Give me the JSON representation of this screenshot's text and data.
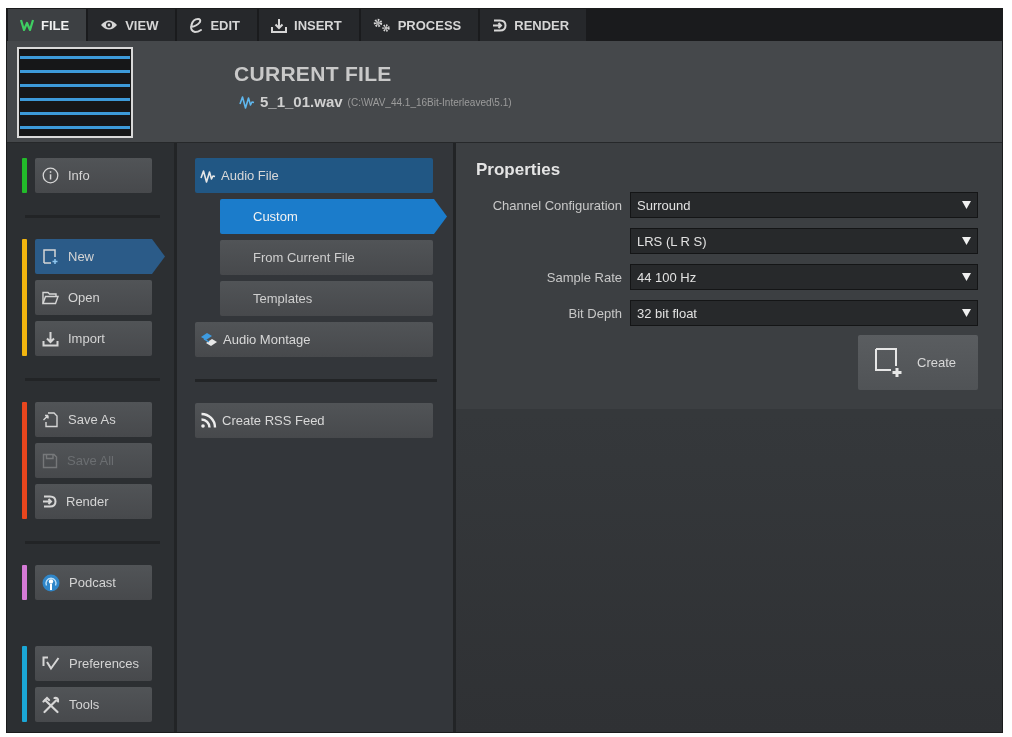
{
  "tabs": [
    {
      "label": "FILE",
      "selected": true
    },
    {
      "label": "VIEW",
      "selected": false
    },
    {
      "label": "EDIT",
      "selected": false
    },
    {
      "label": "INSERT",
      "selected": false
    },
    {
      "label": "PROCESS",
      "selected": false
    },
    {
      "label": "RENDER",
      "selected": false
    }
  ],
  "current_file": {
    "title": "CURRENT FILE",
    "file_name": "5_1_01.wav",
    "path": "(C:\\WAV_44.1_16Bit-Interleaved\\5.1)"
  },
  "sidebar": {
    "groups": [
      {
        "color": "#22bb2a",
        "items": [
          {
            "label": "Info",
            "selected": false,
            "disabled": false
          }
        ]
      },
      {
        "color": "#f2b50f",
        "items": [
          {
            "label": "New",
            "selected": true,
            "disabled": false
          },
          {
            "label": "Open",
            "selected": false,
            "disabled": false
          },
          {
            "label": "Import",
            "selected": false,
            "disabled": false
          }
        ]
      },
      {
        "color": "#e8461e",
        "items": [
          {
            "label": "Save As",
            "selected": false,
            "disabled": false
          },
          {
            "label": "Save All",
            "selected": false,
            "disabled": true
          },
          {
            "label": "Render",
            "selected": false,
            "disabled": false
          }
        ]
      },
      {
        "color": "#d57ad6",
        "items": [
          {
            "label": "Podcast",
            "selected": false,
            "disabled": false
          }
        ]
      },
      {
        "color": "#1ba7d6",
        "items": [
          {
            "label": "Preferences",
            "selected": false,
            "disabled": false
          },
          {
            "label": "Tools",
            "selected": false,
            "disabled": false
          }
        ]
      }
    ]
  },
  "submenu": {
    "groups": [
      {
        "items": [
          {
            "label": "Audio File",
            "selected": true,
            "children": [
              {
                "label": "Custom",
                "selected": true
              },
              {
                "label": "From Current File",
                "selected": false
              },
              {
                "label": "Templates",
                "selected": false
              }
            ]
          },
          {
            "label": "Audio Montage",
            "selected": false
          }
        ]
      },
      {
        "items": [
          {
            "label": "Create RSS Feed",
            "selected": false
          }
        ]
      }
    ]
  },
  "properties": {
    "title": "Properties",
    "fields": [
      {
        "label": "Channel Configuration",
        "value": "Surround"
      },
      {
        "value": "LRS (L R S)"
      },
      {
        "label": "Sample Rate",
        "value": "44 100 Hz"
      },
      {
        "label": "Bit Depth",
        "value": "32 bit float"
      }
    ],
    "create_button": "Create"
  }
}
